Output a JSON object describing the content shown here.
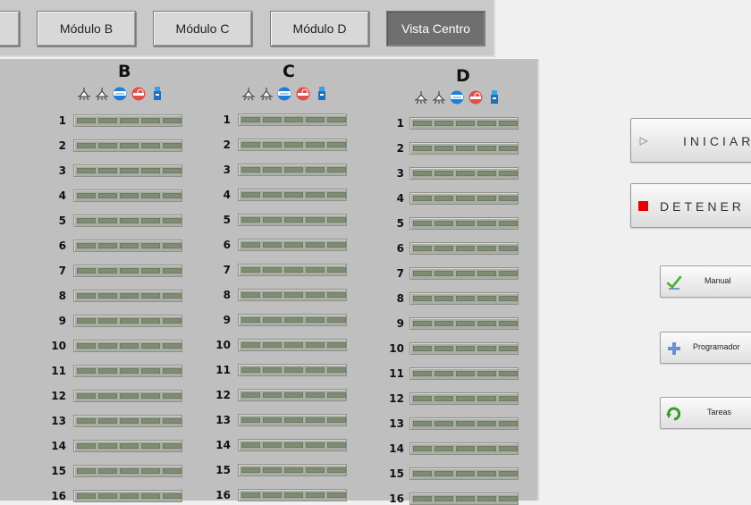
{
  "tabs": [
    "Módulo B",
    "Módulo C",
    "Módulo D",
    "Vista Centro"
  ],
  "active_tab": "Vista Centro",
  "modules": [
    {
      "name": "B"
    },
    {
      "name": "C"
    },
    {
      "name": "D"
    }
  ],
  "rows": [
    "1",
    "2",
    "3",
    "4",
    "5",
    "6",
    "7",
    "8",
    "9",
    "10",
    "11",
    "12",
    "13",
    "14",
    "15",
    "16"
  ],
  "status_icons": [
    "lamp-icon",
    "lamp-icon",
    "air-conditioner-icon",
    "no-smoking-sensor-icon",
    "water-dispenser-icon"
  ],
  "controls": {
    "start_label": "INICIAR",
    "stop_label": "DETENER",
    "manual_label": "Manual",
    "scheduler_label": "Programador",
    "tasks_label": "Tareas"
  },
  "colors": {
    "stop_square": "#e60000",
    "led_off": "#7f8c73",
    "active_tab": "#6f6f6f",
    "panel": "#bfbfbf"
  }
}
